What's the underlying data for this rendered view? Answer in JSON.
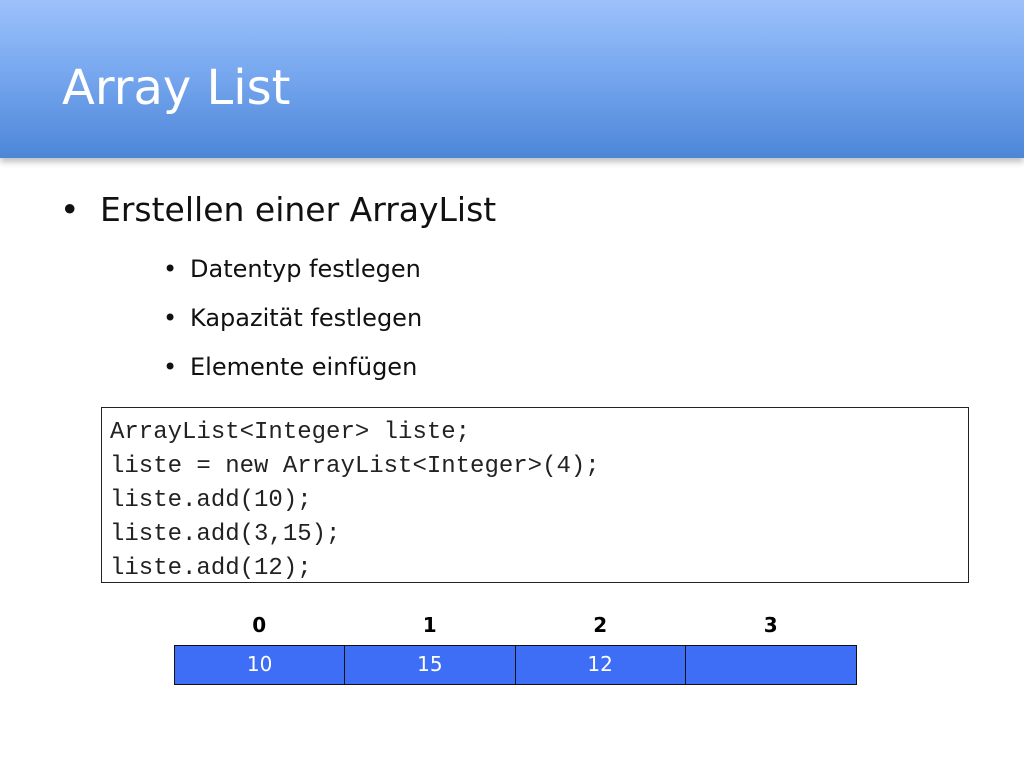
{
  "title": "Array List",
  "main_bullet": {
    "marker": "•",
    "text": "Erstellen einer ArrayList"
  },
  "sub_bullets": [
    {
      "marker": "•",
      "text": "Datentyp festlegen"
    },
    {
      "marker": "•",
      "text": "Kapazität festlegen"
    },
    {
      "marker": "•",
      "text": "Elemente einfügen"
    }
  ],
  "code_lines": [
    "ArrayList<Integer> liste;",
    "liste = new ArrayList<Integer>(4);",
    "liste.add(10);",
    "liste.add(3,15);",
    "liste.add(12);"
  ],
  "array": {
    "indices": [
      "0",
      "1",
      "2",
      "3"
    ],
    "values": [
      "10",
      "15",
      "12",
      ""
    ]
  },
  "colors": {
    "title_bar": "#78a8ef",
    "cell_fill": "#3f6ef6",
    "cell_text": "#ffffff"
  }
}
